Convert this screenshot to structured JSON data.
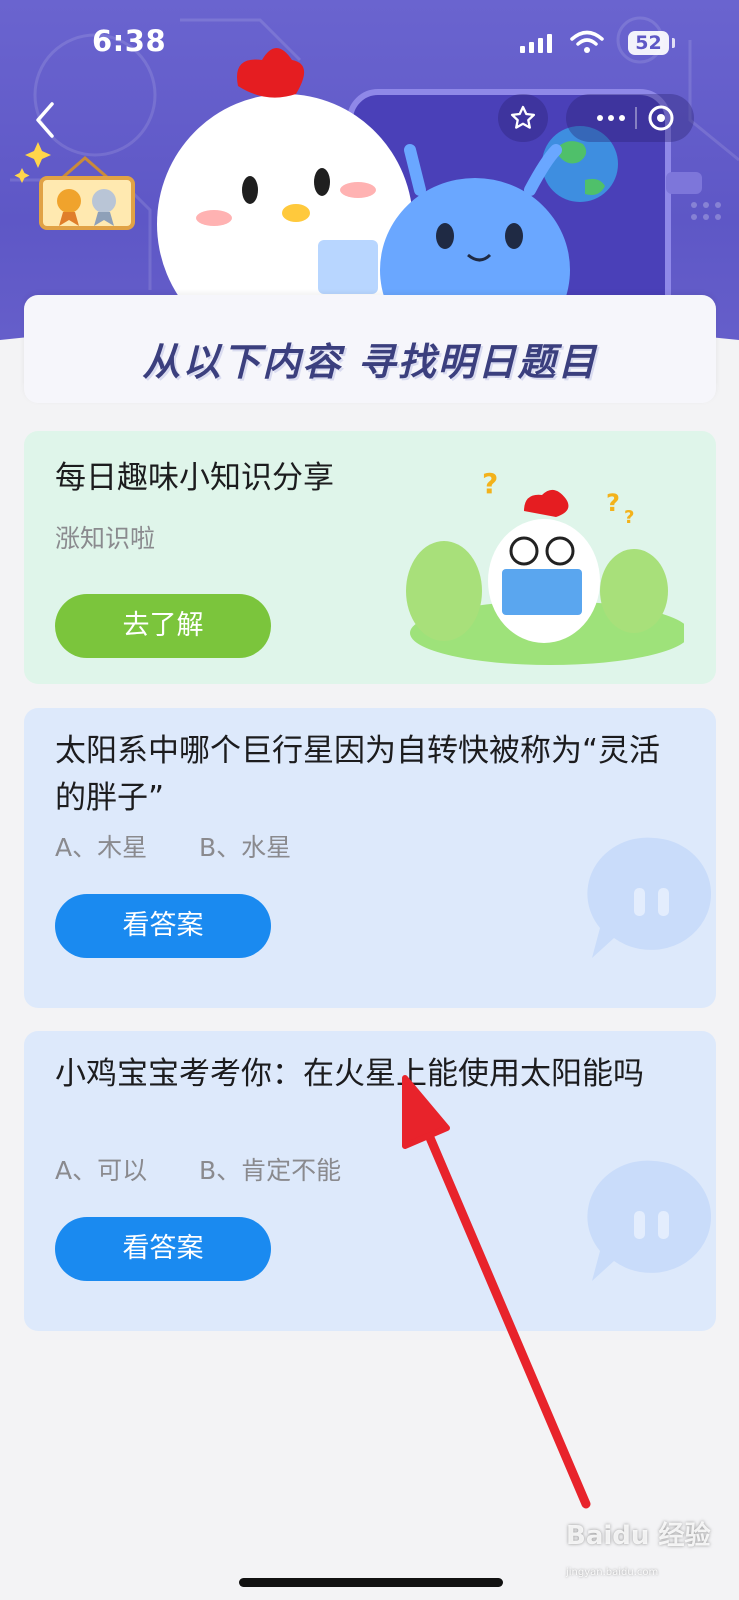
{
  "status_bar": {
    "time": "6:38",
    "battery": "52"
  },
  "header": {
    "banner_title": "从以下内容 寻找明日题目"
  },
  "fact_card": {
    "title": "每日趣味小知识分享",
    "subtitle": "涨知识啦",
    "button_label": "去了解"
  },
  "questions": [
    {
      "question": "太阳系中哪个巨行星因为自转快被称为“灵活的胖子”",
      "option_a": "A、木星",
      "option_b": "B、水星",
      "button_label": "看答案"
    },
    {
      "question": "小鸡宝宝考考你：在火星上能使用太阳能吗",
      "option_a": "A、可以",
      "option_b": "B、肯定不能",
      "button_label": "看答案"
    }
  ],
  "watermark": {
    "brand": "Baidu 经验",
    "url": "jingyan.baidu.com"
  },
  "colors": {
    "header_bg": "#5e57c6",
    "fact_card_bg": "#dff5ea",
    "question_card_bg": "#dde9fb",
    "fact_button": "#7bc53c",
    "answer_button": "#1a8af0",
    "annotation_arrow": "#e8232b"
  }
}
